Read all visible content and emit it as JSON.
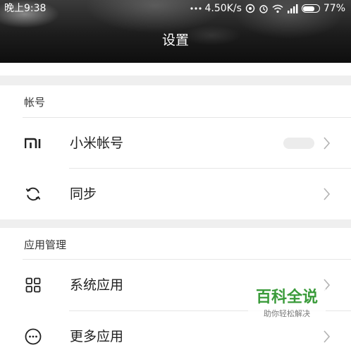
{
  "statusbar": {
    "time": "晚上9:38",
    "network_speed": "4.50K/s",
    "battery": "77%",
    "battery_level": 0.77
  },
  "header": {
    "title": "设置"
  },
  "sections": {
    "account": {
      "label": "帐号",
      "items": [
        {
          "label": "小米帐号",
          "icon": "mi-logo-icon"
        },
        {
          "label": "同步",
          "icon": "sync-icon"
        }
      ]
    },
    "apps": {
      "label": "应用管理",
      "items": [
        {
          "label": "系统应用",
          "icon": "grid-icon"
        },
        {
          "label": "更多应用",
          "icon": "more-icon"
        }
      ]
    }
  },
  "watermark": {
    "title": "百科全说",
    "subtitle": "助你轻松解决"
  }
}
